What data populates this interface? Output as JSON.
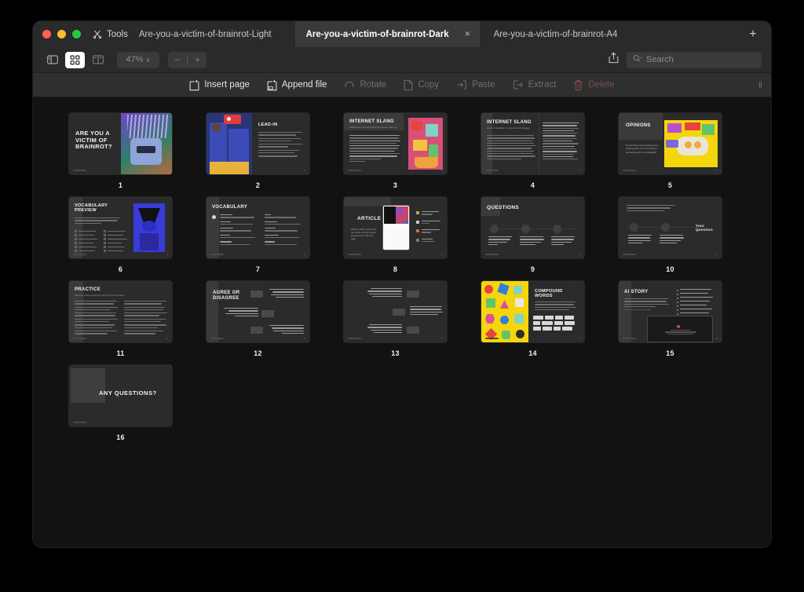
{
  "window": {
    "traffic_lights": [
      "close",
      "minimize",
      "maximize"
    ],
    "tools_label": "Tools"
  },
  "tabs": [
    {
      "label": "Are-you-a-victim-of-brainrot-Light",
      "active": false,
      "closable": false
    },
    {
      "label": "Are-you-a-victim-of-brainrot-Dark",
      "active": true,
      "closable": true,
      "close_glyph": "×"
    },
    {
      "label": "Are-you-a-victim-of-brainrot-A4",
      "active": false,
      "closable": false
    }
  ],
  "new_tab_glyph": "+",
  "toolbar": {
    "view_sidebar_icon": "sidebar-icon",
    "grid_view_icon": "grid-view-icon",
    "two_page_view_icon": "two-page-view-icon",
    "zoom_level": "47%",
    "zoom_chevron": "∨",
    "zoom_out": "−",
    "zoom_divider": "|",
    "zoom_in": "+",
    "share_icon": "share-icon",
    "search_placeholder": "Search",
    "search_value": ""
  },
  "actions": [
    {
      "label": "Insert page",
      "icon": "insert-page-icon",
      "state": "enabled"
    },
    {
      "label": "Append file",
      "icon": "append-file-icon",
      "state": "enabled"
    },
    {
      "label": "Rotate",
      "icon": "rotate-icon",
      "state": "disabled"
    },
    {
      "label": "Copy",
      "icon": "copy-icon",
      "state": "disabled"
    },
    {
      "label": "Paste",
      "icon": "paste-icon",
      "state": "disabled"
    },
    {
      "label": "Extract",
      "icon": "extract-icon",
      "state": "disabled"
    },
    {
      "label": "Delete",
      "icon": "delete-icon",
      "state": "danger"
    }
  ],
  "grip_glyph": "‖",
  "pages": [
    {
      "number": "1",
      "title": "ARE YOU A VICTIM OF BRAINROT?",
      "layout": "cover-art-right"
    },
    {
      "number": "2",
      "title": "LEAD-IN",
      "layout": "art-left-list-right"
    },
    {
      "number": "3",
      "title": "INTERNET SLANG",
      "subtitle": "Slide Bumper: Do some slang they know to warm up.",
      "layout": "text-left-art-right"
    },
    {
      "number": "4",
      "title": "INTERNET SLANG",
      "subtitle": "Here's a breakdown in more standard language",
      "layout": "two-column-text"
    },
    {
      "number": "5",
      "title": "OPINIONS",
      "subtitle": "Do you think internet slang is just a passing trend, or is it becoming a permanent part of our language?",
      "layout": "text-left-art-right-yellow"
    },
    {
      "number": "6",
      "title": "VOCABULARY PREVIEW",
      "layout": "checklist-left-art-right"
    },
    {
      "number": "7",
      "title": "VOCABULARY",
      "layout": "glossary-two-column"
    },
    {
      "number": "8",
      "title": "ARTICLE",
      "subtitle": "Read the article, focus on the new words, and then answer the questions on the next page.",
      "layout": "article-device-center"
    },
    {
      "number": "9",
      "title": "QUESTIONS",
      "layout": "three-numbered-questions"
    },
    {
      "number": "10",
      "title": "Your Question",
      "layout": "two-numbered-questions"
    },
    {
      "number": "11",
      "title": "PRACTICE",
      "subtitle": "Match the sentence beginnings with their correct endings.",
      "layout": "practice-two-column"
    },
    {
      "number": "12",
      "title": "AGREE OR DISAGREE",
      "layout": "agree-disagree"
    },
    {
      "number": "13",
      "title": "",
      "layout": "agree-disagree-2"
    },
    {
      "number": "14",
      "title": "COMPOUND WORDS",
      "layout": "art-left-word-tiles-right"
    },
    {
      "number": "15",
      "title": "AI STORY",
      "layout": "ai-story-device"
    },
    {
      "number": "16",
      "title": "ANY QUESTIONS?",
      "layout": "closing"
    }
  ],
  "colors": {
    "window_chrome": "#2a2a2a",
    "active_tab": "#3a3a3a",
    "canvas": "#121212",
    "thumb": "#2b2b2b",
    "accent_blue": "#3b3bbf",
    "accent_yellow": "#f5d60a",
    "danger": "#8b4a4a"
  }
}
